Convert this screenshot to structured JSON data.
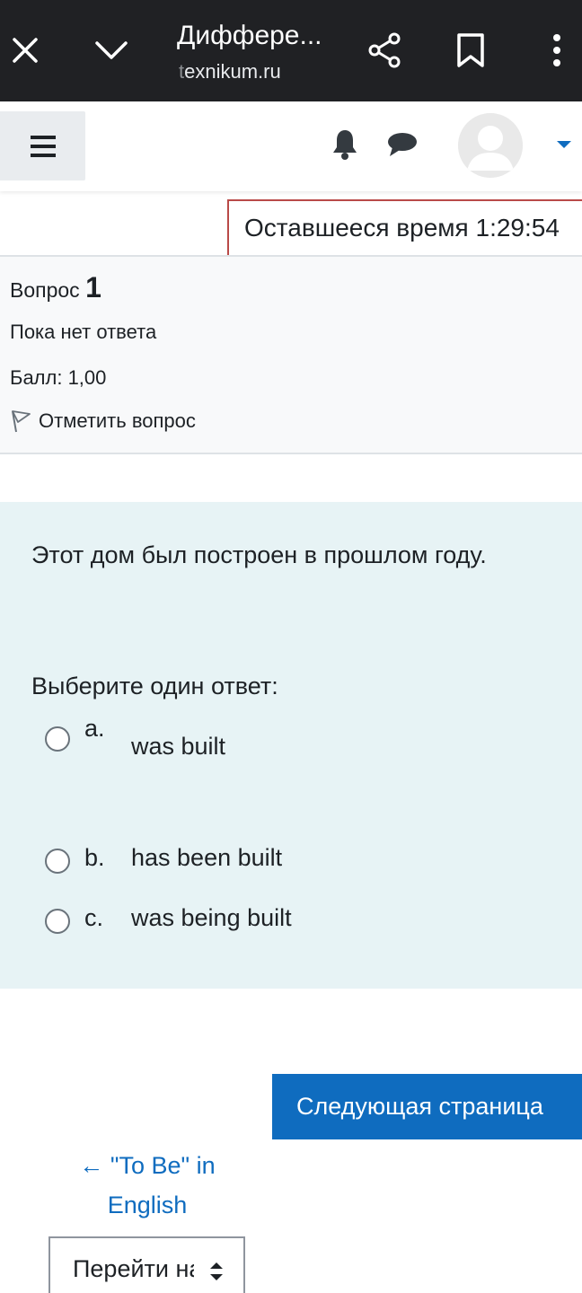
{
  "browser": {
    "title": "Диффере...",
    "domain_faded": "t",
    "domain_rest": "exnikum.ru"
  },
  "navbar": {
    "icons": [
      "hamburger-icon",
      "bell-icon",
      "chat-icon",
      "avatar",
      "caret-down-icon"
    ]
  },
  "timer": {
    "label": "Оставшееся время",
    "value": "1:29:54"
  },
  "question_info": {
    "label": "Вопрос",
    "number": "1",
    "state": "Пока нет ответа",
    "grade": "Балл: 1,00",
    "flag_label": "Отметить вопрос"
  },
  "question": {
    "text": "Этот дом был построен в прошлом году.",
    "prompt": "Выберите один ответ:",
    "options": [
      {
        "letter": "a.",
        "text": "was built"
      },
      {
        "letter": "b.",
        "text": "has been built"
      },
      {
        "letter": "c.",
        "text": "was being built"
      }
    ]
  },
  "navigation": {
    "next_label": "Следующая страница",
    "prev_label": "← \"To Be\" in English",
    "jump_label": "Перейти на..."
  },
  "colors": {
    "accent": "#0f6cbf",
    "timer_border": "#b94a48",
    "question_bg": "#e7f3f5",
    "browser_bar": "#202124"
  }
}
